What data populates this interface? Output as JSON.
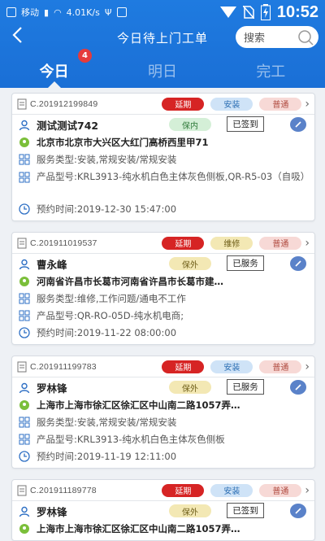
{
  "status_bar": {
    "carrier": "移动",
    "net_speed": "4.01K/s",
    "clock": "10:52"
  },
  "header": {
    "back_label": "‹",
    "title": "今日待上门工单",
    "search_placeholder": "搜索"
  },
  "tabs": [
    {
      "label": "今日",
      "badge": "4"
    },
    {
      "label": "明日"
    },
    {
      "label": "完工"
    }
  ],
  "orders": [
    {
      "order_no": "C.201912199849",
      "status": "延期",
      "type": "安装",
      "priority": "普通",
      "customer": "测试测试742",
      "warranty": "保内",
      "sign_status": "已签到",
      "address": "北京市北京市大兴区大红门高桥西里甲71",
      "service": "服务类型:安装,常规安装/常规安装",
      "product": "产品型号:KRL3913-纯水机白色主体灰色侧板,QR-R5-03（自吸）",
      "appointment": "预约时间:2019-12-30 15:47:00"
    },
    {
      "order_no": "C.201911019537",
      "status": "延期",
      "type": "维修",
      "priority": "普通",
      "customer": "曹永峰",
      "warranty": "保外",
      "sign_status": "已服务",
      "address": "河南省许昌市长葛市河南省许昌市长葛市建…",
      "service": "服务类型:维修,工作问题/通电不工作",
      "product": "产品型号:QR-RO-05D-纯水机电商;",
      "appointment": "预约时间:2019-11-22 08:00:00"
    },
    {
      "order_no": "C.201911199783",
      "status": "延期",
      "type": "安装",
      "priority": "普通",
      "customer": "罗林锋",
      "warranty": "保外",
      "sign_status": "已服务",
      "address": "上海市上海市徐汇区徐汇区中山南二路1057弄…",
      "service": "服务类型:安装,常规安装/常规安装",
      "product": "产品型号:KRL3913-纯水机白色主体灰色侧板",
      "appointment": "预约时间:2019-11-19 12:11:00"
    },
    {
      "order_no": "C.201911189778",
      "status": "延期",
      "type": "安装",
      "priority": "普通",
      "customer": "罗林锋",
      "warranty": "保外",
      "sign_status": "已签到",
      "address": "上海市上海市徐汇区徐汇区中山南二路1057弄…"
    }
  ],
  "colors": {
    "header_blue": "#1f7be0",
    "status_red": "#d62424",
    "type_blue": "#cfe3f7",
    "priority_pink": "#f7d9d6",
    "warranty_green": "#d4efd7",
    "warranty_yellow": "#f3e8b4"
  }
}
